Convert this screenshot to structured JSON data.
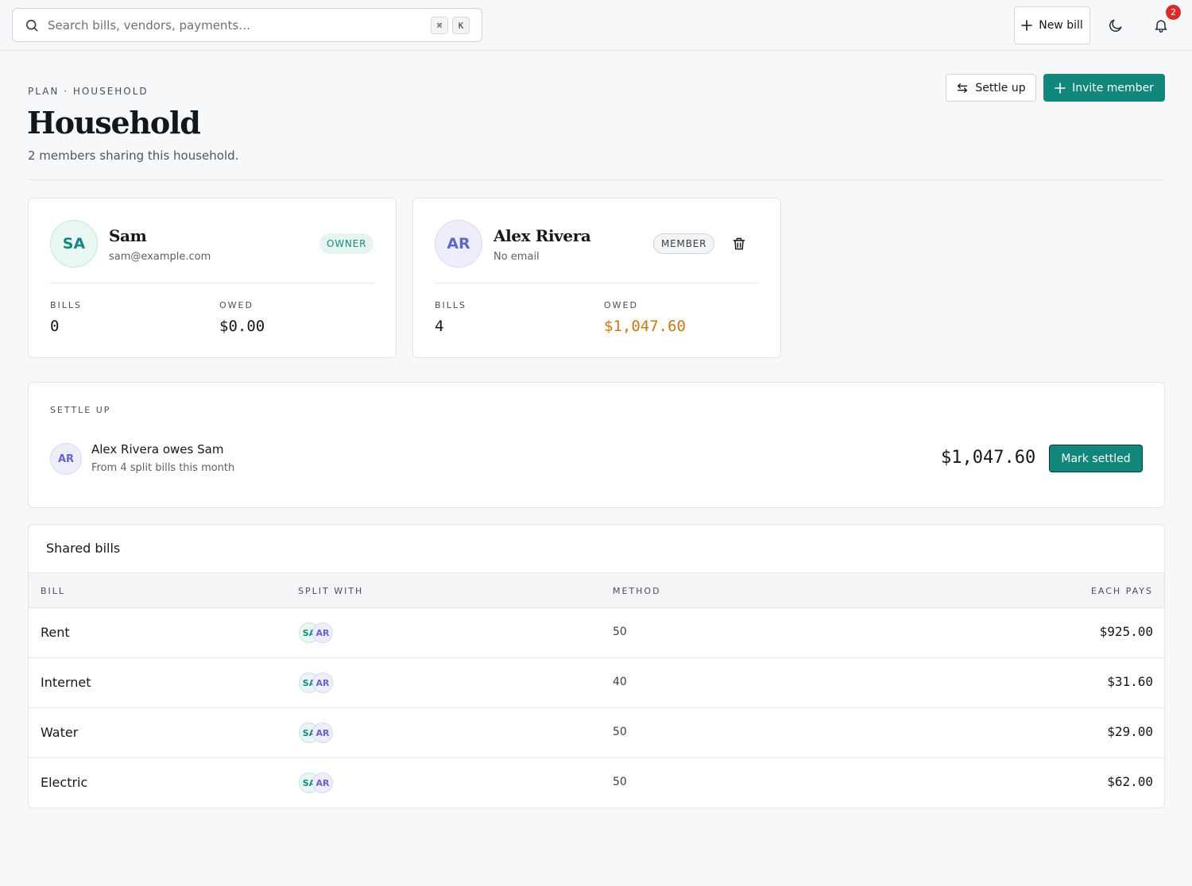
{
  "topbar": {
    "search_placeholder": "Search bills, vendors, payments…",
    "shortcut_keys": [
      "⌘",
      "K"
    ],
    "new_bill_label": "New bill",
    "notification_count": "2"
  },
  "header": {
    "eyebrow": "PLAN · HOUSEHOLD",
    "title": "Household",
    "subtitle": "2 members sharing this household.",
    "settle_up_label": "Settle up",
    "invite_label": "Invite member"
  },
  "members": [
    {
      "initials": "SA",
      "name": "Sam",
      "email": "sam@example.com",
      "role": "OWNER",
      "bills_label": "BILLS",
      "bills": "0",
      "owed_label": "OWED",
      "owed": "$0.00"
    },
    {
      "initials": "AR",
      "name": "Alex Rivera",
      "email": "No email",
      "role": "MEMBER",
      "bills_label": "BILLS",
      "bills": "4",
      "owed_label": "OWED",
      "owed": "$1,047.60"
    }
  ],
  "settle": {
    "title": "SETTLE UP",
    "initials": "AR",
    "line": "Alex Rivera owes Sam",
    "sub": "From 4 split bills this month",
    "amount": "$1,047.60",
    "mark_label": "Mark settled"
  },
  "bills": {
    "title": "Shared bills",
    "columns": [
      "BILL",
      "SPLIT WITH",
      "METHOD",
      "EACH PAYS"
    ],
    "rows": [
      {
        "bill": "Rent",
        "split": [
          "SA",
          "AR"
        ],
        "method": "50",
        "each": "$925.00"
      },
      {
        "bill": "Internet",
        "split": [
          "SA",
          "AR"
        ],
        "method": "40",
        "each": "$31.60"
      },
      {
        "bill": "Water",
        "split": [
          "SA",
          "AR"
        ],
        "method": "50",
        "each": "$29.00"
      },
      {
        "bill": "Electric",
        "split": [
          "SA",
          "AR"
        ],
        "method": "50",
        "each": "$62.00"
      }
    ]
  },
  "colors": {
    "accent": "#10877a",
    "owed_highlight": "#c6790f",
    "badge": "#d92b2b"
  }
}
